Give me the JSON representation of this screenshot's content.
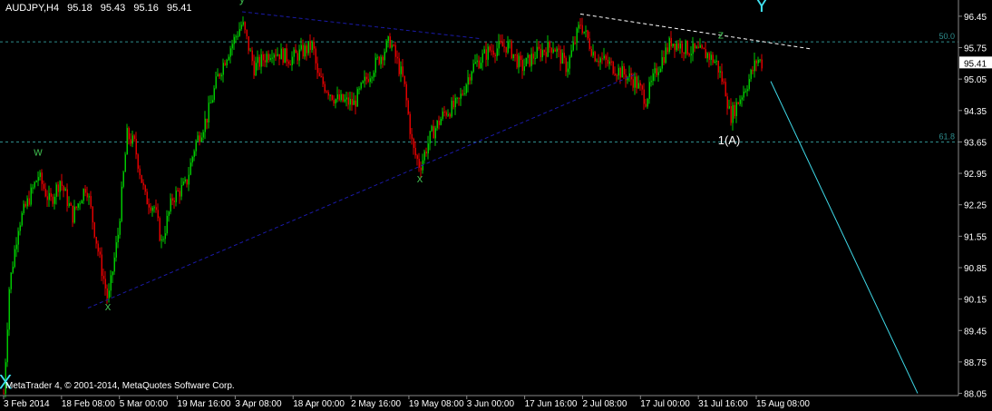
{
  "header": {
    "symbol": "AUDJPY,H4",
    "open": "95.18",
    "high": "95.43",
    "low": "95.16",
    "close": "95.41"
  },
  "footer": {
    "copyright": "MetaTrader 4, © 2001-2014, MetaQuotes Software Corp."
  },
  "colors": {
    "background": "#000000",
    "bull": "#00c800",
    "bear": "#e00000",
    "grid": "#2a4a4a",
    "trendline": "#1a1aa8",
    "label_green": "#3cb44b",
    "label_cyan": "#40e0f0",
    "projection": "#3fd9e8"
  },
  "chart_data": {
    "type": "candlestick",
    "symbol": "AUDJPY",
    "timeframe": "H4",
    "x_ticks": [
      "3 Feb 2014",
      "18 Feb 08:00",
      "5 Mar 00:00",
      "19 Mar 16:00",
      "3 Apr 08:00",
      "18 Apr 00:00",
      "2 May 16:00",
      "19 May 08:00",
      "3 Jun 00:00",
      "17 Jun 16:00",
      "2 Jul 08:00",
      "17 Jul 00:00",
      "31 Jul 16:00",
      "15 Aug 08:00"
    ],
    "y_ticks": [
      "96.45",
      "95.75",
      "95.05",
      "94.35",
      "93.65",
      "92.95",
      "92.25",
      "91.55",
      "90.85",
      "90.15",
      "89.45",
      "88.75",
      "88.05"
    ],
    "ylim": [
      88.0,
      96.65
    ],
    "current_price": "95.41",
    "fib_levels": [
      {
        "label": "50.0",
        "value": 95.88
      },
      {
        "label": "61.8",
        "value": 93.65
      }
    ],
    "wave_labels": [
      {
        "text": "X",
        "bar": 6,
        "price": 88.15,
        "color": "cyan"
      },
      {
        "text": "w",
        "bar": 42,
        "price": 93.35,
        "color": "green"
      },
      {
        "text": "x",
        "bar": 119,
        "price": 89.9,
        "color": "green"
      },
      {
        "text": "y",
        "bar": 267,
        "price": 96.75,
        "color": "green"
      },
      {
        "text": "x",
        "bar": 463,
        "price": 92.75,
        "color": "green"
      },
      {
        "text": "z",
        "bar": 795,
        "price": 95.95,
        "color": "green"
      },
      {
        "text": "Y",
        "bar": 840,
        "price": 96.55,
        "color": "cyan"
      },
      {
        "text": "1(A)",
        "bar": 804,
        "price": 93.6,
        "color": "white"
      }
    ],
    "trendlines": [
      {
        "from": {
          "bar": 97,
          "price": 89.95
        },
        "to": {
          "bar": 700,
          "price": 95.15
        },
        "color": "trendline"
      },
      {
        "from": {
          "bar": 267,
          "price": 96.55
        },
        "to": {
          "bar": 530,
          "price": 95.95
        },
        "color": "trendline"
      },
      {
        "from": {
          "bar": 640,
          "price": 96.5
        },
        "to": {
          "bar": 895,
          "price": 95.72
        },
        "color": "white",
        "dashed": true
      },
      {
        "from": {
          "bar": 850,
          "price": 95.0
        },
        "to": {
          "bar": 1012,
          "price": 88.05
        },
        "color": "projection",
        "dashed": false
      }
    ],
    "price_path": [
      [
        4,
        88.05
      ],
      [
        10,
        90.4
      ],
      [
        20,
        91.8
      ],
      [
        42,
        92.9
      ],
      [
        55,
        92.3
      ],
      [
        66,
        92.8
      ],
      [
        80,
        92.0
      ],
      [
        95,
        92.7
      ],
      [
        110,
        91.0
      ],
      [
        119,
        90.1
      ],
      [
        130,
        91.6
      ],
      [
        140,
        93.8
      ],
      [
        148,
        93.6
      ],
      [
        160,
        92.4
      ],
      [
        170,
        92.2
      ],
      [
        178,
        91.4
      ],
      [
        190,
        92.4
      ],
      [
        205,
        92.7
      ],
      [
        215,
        93.6
      ],
      [
        228,
        94.2
      ],
      [
        240,
        95.1
      ],
      [
        250,
        95.6
      ],
      [
        267,
        96.3
      ],
      [
        280,
        95.3
      ],
      [
        300,
        95.7
      ],
      [
        320,
        95.5
      ],
      [
        345,
        95.8
      ],
      [
        350,
        95.1
      ],
      [
        370,
        94.6
      ],
      [
        390,
        94.5
      ],
      [
        405,
        95.1
      ],
      [
        430,
        95.9
      ],
      [
        445,
        95.0
      ],
      [
        455,
        93.5
      ],
      [
        463,
        93.1
      ],
      [
        475,
        93.8
      ],
      [
        490,
        94.3
      ],
      [
        505,
        94.5
      ],
      [
        520,
        95.3
      ],
      [
        540,
        95.7
      ],
      [
        560,
        95.8
      ],
      [
        575,
        95.3
      ],
      [
        590,
        95.6
      ],
      [
        610,
        95.8
      ],
      [
        625,
        95.3
      ],
      [
        640,
        96.3
      ],
      [
        655,
        95.6
      ],
      [
        670,
        95.4
      ],
      [
        685,
        95.2
      ],
      [
        700,
        95.0
      ],
      [
        712,
        94.6
      ],
      [
        725,
        95.3
      ],
      [
        740,
        95.9
      ],
      [
        760,
        95.7
      ],
      [
        780,
        95.6
      ],
      [
        790,
        95.4
      ],
      [
        800,
        94.8
      ],
      [
        805,
        94.2
      ],
      [
        815,
        94.6
      ],
      [
        825,
        95.0
      ],
      [
        835,
        95.5
      ],
      [
        840,
        95.41
      ]
    ]
  }
}
